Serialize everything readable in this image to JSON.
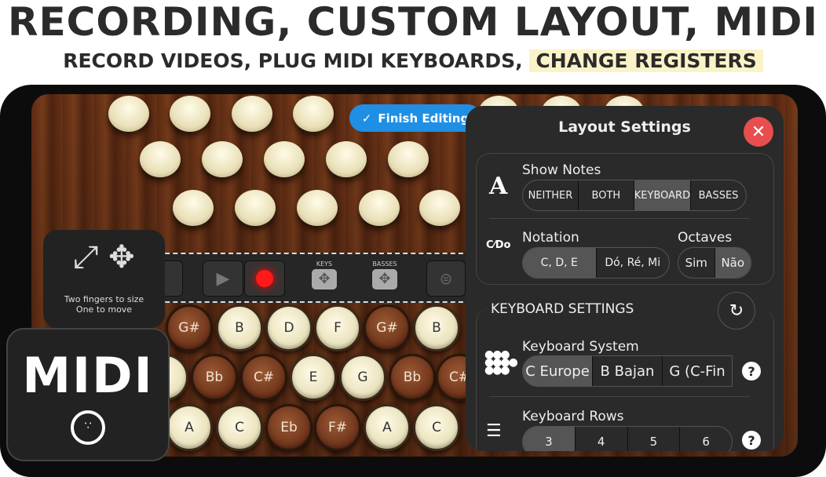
{
  "headline": "RECORDING, CUSTOM LAYOUT, MIDI",
  "subheadline": {
    "text": "RECORD VIDEOS, PLUG MIDI KEYBOARDS,",
    "highlight": "CHANGE REGISTERS"
  },
  "finish_button": {
    "label": "Finish Editing",
    "icon": "check-icon",
    "color": "#1f8fe5"
  },
  "toolbar": {
    "keys_label": "KEYS",
    "basses_label": "BASSES",
    "record_color": "#ff1a1a"
  },
  "hint": {
    "line1": "Two fingers to size",
    "line2": "One to move"
  },
  "midi_badge": {
    "text": "MIDI",
    "icon": "midi-connector-icon"
  },
  "keyboard_rows": [
    [
      {
        "n": "G#",
        "t": "brown"
      },
      {
        "n": "B",
        "t": "cream"
      },
      {
        "n": "D",
        "t": "cream"
      },
      {
        "n": "F",
        "t": "cream"
      },
      {
        "n": "G#",
        "t": "brown"
      },
      {
        "n": "B",
        "t": "cream"
      }
    ],
    [
      {
        "n": "",
        "t": "cream"
      },
      {
        "n": "Bb",
        "t": "brown"
      },
      {
        "n": "C#",
        "t": "brown"
      },
      {
        "n": "E",
        "t": "cream"
      },
      {
        "n": "G",
        "t": "cream"
      },
      {
        "n": "Bb",
        "t": "brown"
      },
      {
        "n": "C#",
        "t": "brown"
      }
    ],
    [
      {
        "n": "A",
        "t": "cream"
      },
      {
        "n": "C",
        "t": "cream"
      },
      {
        "n": "Eb",
        "t": "brown"
      },
      {
        "n": "F#",
        "t": "brown"
      },
      {
        "n": "A",
        "t": "cream"
      },
      {
        "n": "C",
        "t": "cream"
      }
    ]
  ],
  "panel": {
    "title": "Layout Settings",
    "show_notes": {
      "label": "Show Notes",
      "options": [
        "NEITHER",
        "BOTH",
        "KEYBOARD",
        "BASSES"
      ],
      "selected": "KEYBOARD"
    },
    "notation": {
      "label": "Notation",
      "options": [
        "C, D, E",
        "Dó, Ré, Mi"
      ],
      "selected": "C, D, E"
    },
    "octaves": {
      "label": "Octaves",
      "options": [
        "Sim",
        "Não"
      ],
      "selected": "Não"
    },
    "keyboard_settings_heading": "KEYBOARD SETTINGS",
    "keyboard_system": {
      "label": "Keyboard System",
      "options": [
        "C Europe",
        "B Bajan",
        "G (C-Fin"
      ],
      "selected": "C Europe"
    },
    "keyboard_rows": {
      "label": "Keyboard Rows",
      "options": [
        "3",
        "4",
        "5",
        "6"
      ],
      "selected": "3"
    }
  }
}
